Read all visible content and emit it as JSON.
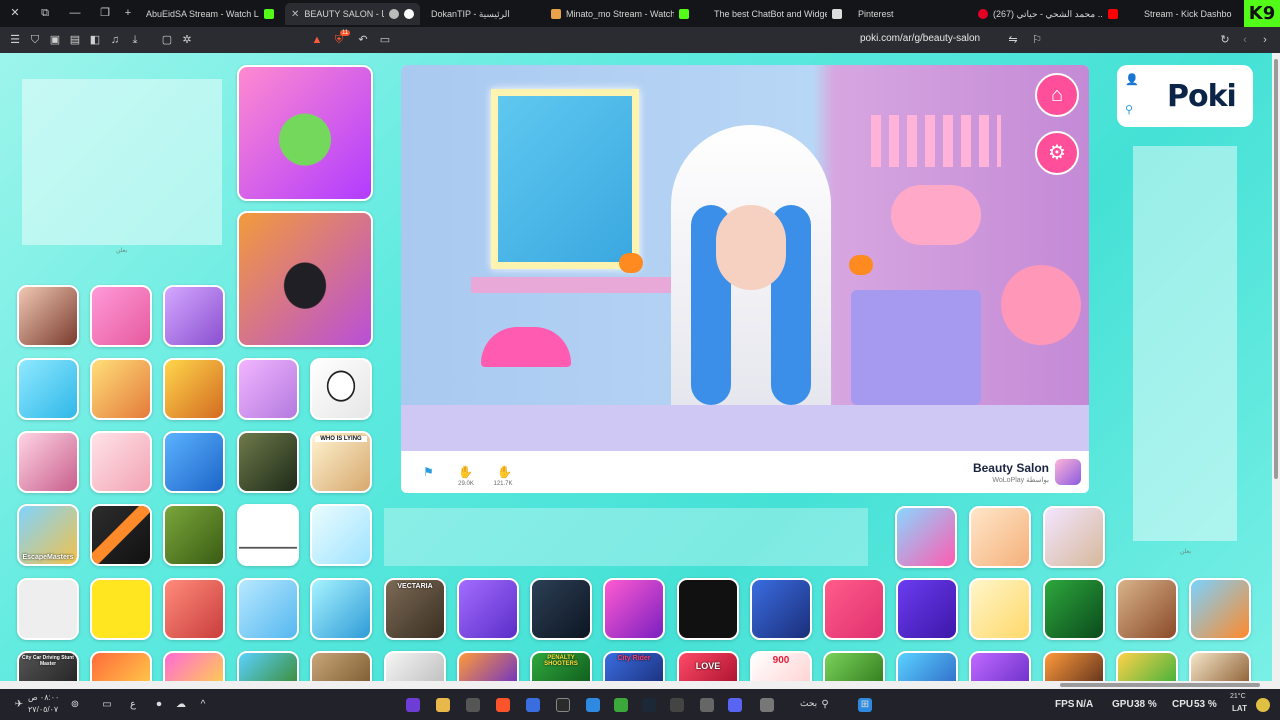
{
  "tabs": [
    {
      "label": "AbuEidSA Stream - Watch Live",
      "active": false
    },
    {
      "label": "BEAUTY SALON - مجانًا",
      "active": true
    },
    {
      "label": "DokanTIP - الرئيسية",
      "active": false
    },
    {
      "label": "Minato_mo Stream - Watch Live",
      "active": false
    },
    {
      "label": "The best ChatBot and Widgets",
      "active": false
    },
    {
      "label": "Pinterest",
      "active": false
    },
    {
      "label": "(267) محمد الشحي - حياتي ..",
      "active": false
    },
    {
      "label": "Stream - Kick Dashboard",
      "active": false
    }
  ],
  "brand_badge": "K9",
  "toolbar": {
    "url": "poki.com/ar/g/beauty-salon",
    "brave_badge": "11"
  },
  "page": {
    "ad_label": "يعلن",
    "game_title": "Beauty Salon",
    "game_by": "WoLoPlay بواسطة",
    "dislike_count": "29.0K",
    "like_count": "121.7K",
    "logo_text": "Poki"
  },
  "tile_titles": {
    "escape_masters": "EscapeMasters",
    "who_is_lying": "WHO IS LYING",
    "vectaria": "VECTARIA",
    "penalty_shooters": "PENALTY SHOOTERS",
    "city_rider": "City Rider",
    "love": "LOVE",
    "nine_hundred": "900",
    "city_car": "City Car Driving Stunt Master"
  },
  "taskbar": {
    "clock_time": "٠٨:٠٠ ص",
    "clock_date": "٢٧/٠٥/٠٧",
    "search_label": "بحث",
    "fps_label": "FPS",
    "fps_value": "N/A",
    "gpu_label": "GPU",
    "gpu_value": "38 %",
    "cpu_label": "CPU",
    "cpu_value": "53 %",
    "weather_temp": "21°C",
    "lang": "LAT"
  },
  "colors": {
    "page_bg": "#45e1d6",
    "accent_pink": "#ff4f9a",
    "kick_green": "#53fc18",
    "poki_navy": "#0b2447"
  }
}
